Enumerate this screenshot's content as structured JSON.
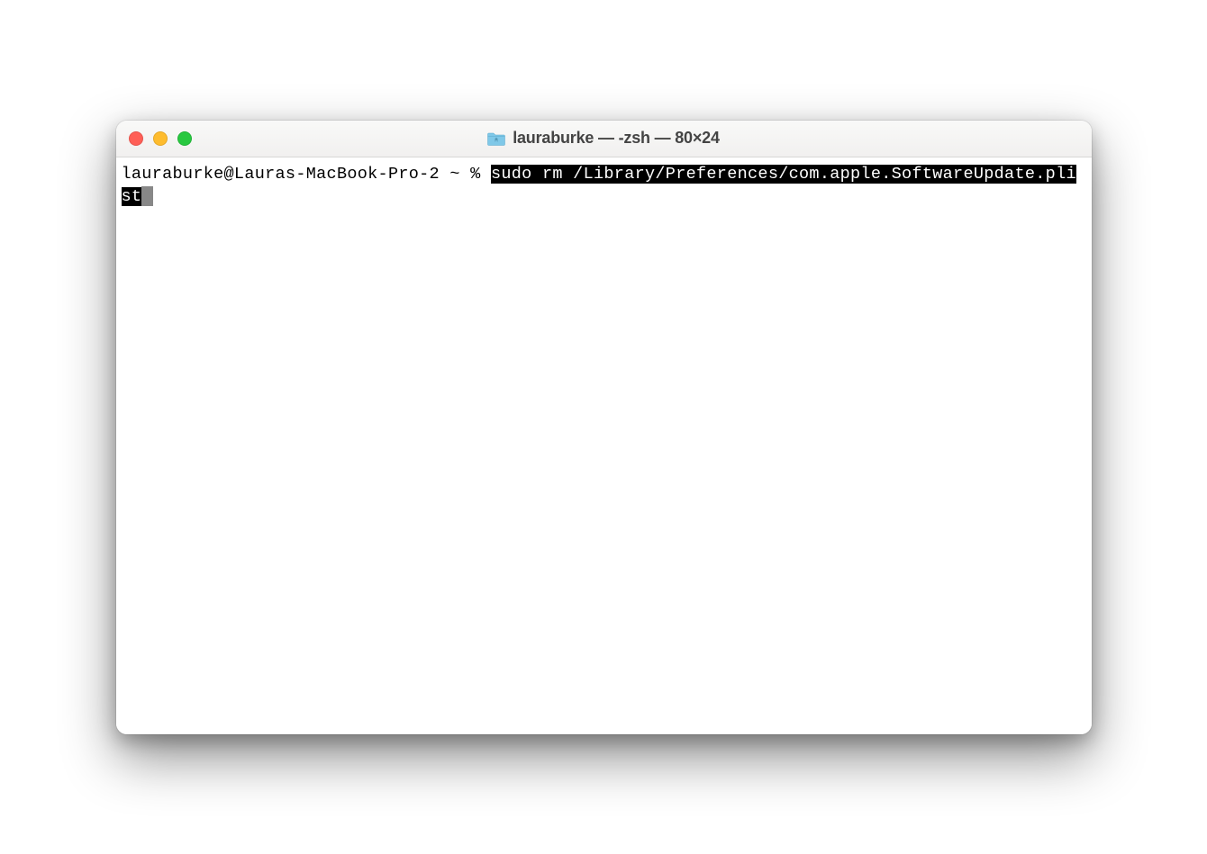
{
  "window": {
    "title": "lauraburke — -zsh — 80×24"
  },
  "terminal": {
    "prompt": "lauraburke@Lauras-MacBook-Pro-2 ~ % ",
    "command": "sudo rm /Library/Preferences/com.apple.SoftwareUpdate.plist"
  }
}
